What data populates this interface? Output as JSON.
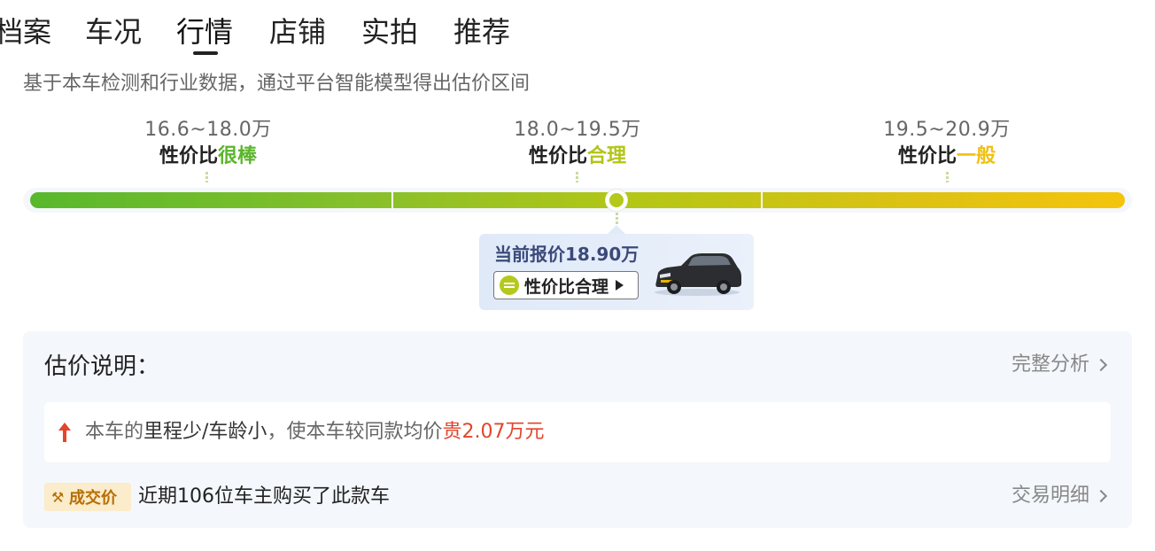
{
  "tabs": [
    {
      "label": "档案"
    },
    {
      "label": "车况"
    },
    {
      "label": "行情",
      "active": true
    },
    {
      "label": "店铺"
    },
    {
      "label": "实拍"
    },
    {
      "label": "推荐"
    }
  ],
  "subtitle": "基于本车检测和行业数据，通过平台智能模型得出估价区间",
  "bands": [
    {
      "range": "16.6~18.0万",
      "prefix": "性价比",
      "rating": "很棒",
      "color": "#5bb52b"
    },
    {
      "range": "18.0~19.5万",
      "prefix": "性价比",
      "rating": "合理",
      "color": "#b3c417"
    },
    {
      "range": "19.5~20.9万",
      "prefix": "性价比",
      "rating": "一般",
      "color": "#f0c012"
    }
  ],
  "current": {
    "price_label": "当前报价18.90万",
    "rating_label": "性价比合理",
    "icon": "equal-circle-icon"
  },
  "explanation": {
    "title": "估价说明：",
    "full_analysis_link": "完整分析",
    "reason_prefix": "本车的",
    "reason_highlight": "里程少/车龄小",
    "reason_middle": "，使本车较同款均价",
    "reason_amount": "贵2.07万元",
    "deal_badge": "成交价",
    "deal_text": "近期106位车主购买了此款车",
    "deal_link": "交易明细"
  },
  "colors": {
    "accent_red": "#e2452c",
    "good": "#5bb52b",
    "fair": "#b3c417",
    "average": "#f0c012",
    "badge_text": "#b66e05"
  }
}
